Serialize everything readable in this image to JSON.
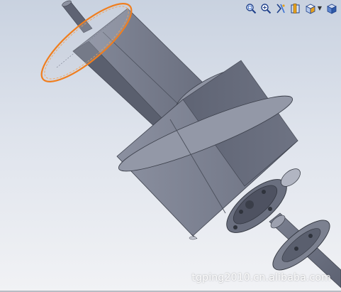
{
  "toolbar": {
    "buttons": [
      {
        "id": "zoom-to-fit",
        "icon": "zoom-to-fit-icon"
      },
      {
        "id": "zoom-to-area",
        "icon": "zoom-to-area-icon"
      },
      {
        "id": "previous-view",
        "icon": "previous-view-icon"
      },
      {
        "id": "section-view",
        "icon": "section-view-icon"
      },
      {
        "id": "view-orientation",
        "icon": "view-orientation-icon",
        "has_dropdown": true
      },
      {
        "id": "display-style",
        "icon": "display-style-icon"
      }
    ]
  },
  "watermark": "tgping2010.cn.alibaba.com",
  "colors": {
    "part_body": "#7a7f8f",
    "part_light": "#9ea3b2",
    "part_dark": "#4f5463",
    "selected_edge": "#f07e1e"
  }
}
